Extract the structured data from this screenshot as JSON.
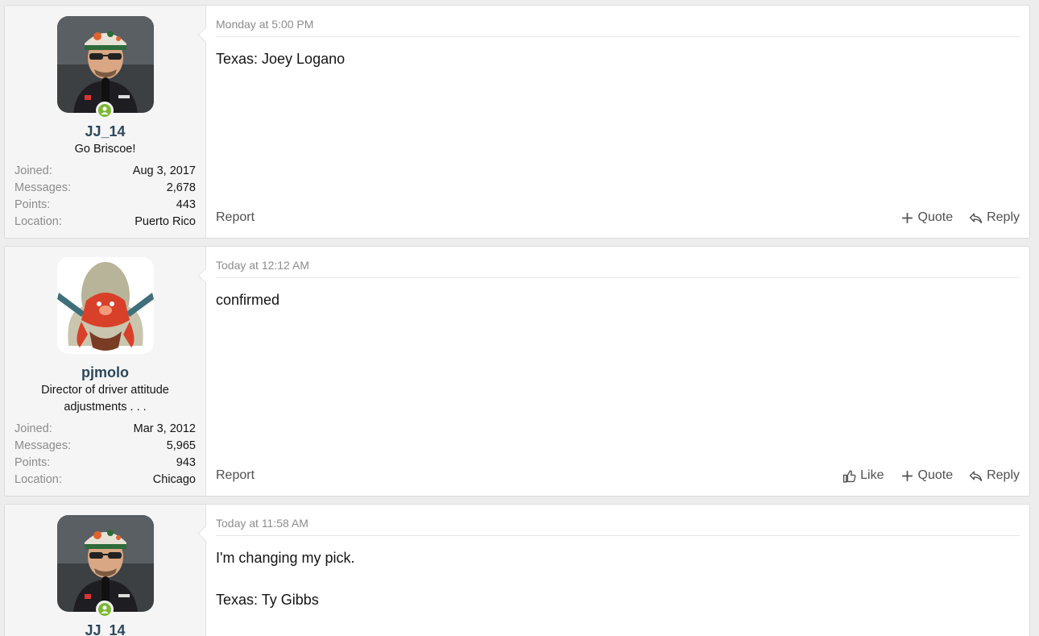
{
  "posts": [
    {
      "author": "JJ_14",
      "user_title": "Go Briscoe!",
      "stats": [
        {
          "label": "Joined:",
          "value": "Aug 3, 2017"
        },
        {
          "label": "Messages:",
          "value": "2,678"
        },
        {
          "label": "Points:",
          "value": "443"
        },
        {
          "label": "Location:",
          "value": "Puerto Rico"
        }
      ],
      "date": "Monday at 5:00 PM",
      "body": [
        "Texas: Joey Logano"
      ],
      "report": "Report",
      "quote": "Quote",
      "reply": "Reply"
    },
    {
      "author": "pjmolo",
      "user_title": "Director of driver attitude adjustments . . .",
      "stats": [
        {
          "label": "Joined:",
          "value": "Mar 3, 2012"
        },
        {
          "label": "Messages:",
          "value": "5,965"
        },
        {
          "label": "Points:",
          "value": "943"
        },
        {
          "label": "Location:",
          "value": "Chicago"
        }
      ],
      "date": "Today at 12:12 AM",
      "body": [
        "confirmed"
      ],
      "report": "Report",
      "like": "Like",
      "quote": "Quote",
      "reply": "Reply"
    },
    {
      "author": "JJ_14",
      "date": "Today at 11:58 AM",
      "body": [
        "I'm changing my pick.",
        "",
        "Texas: Ty Gibbs"
      ]
    }
  ],
  "colors": {
    "username": "#2b485c",
    "online": "#7cb834",
    "muted": "#8c8c8c"
  }
}
